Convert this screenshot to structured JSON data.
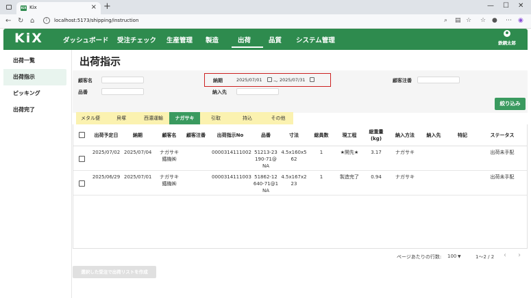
{
  "browser": {
    "tab_title": "Kix",
    "favicon_text": "KiX",
    "url": "localhost:5173/shipping/instruction"
  },
  "app": {
    "logo": "KiX",
    "nav": [
      "ダッシュボード",
      "受注チェック",
      "生産管理",
      "製造",
      "出荷",
      "品質",
      "システム管理"
    ],
    "active_nav": "出荷",
    "user_name": "鉄鋼太郎"
  },
  "sidebar": {
    "items": [
      {
        "label": "出荷一覧",
        "active": false
      },
      {
        "label": "出荷指示",
        "active": true
      },
      {
        "label": "ピッキング",
        "active": false
      },
      {
        "label": "出荷完了",
        "active": false
      }
    ]
  },
  "page": {
    "title": "出荷指示"
  },
  "filters": {
    "customer_label": "顧客名",
    "customer_value": "",
    "part_label": "品番",
    "part_value": "",
    "due_label": "納期",
    "due_from": "2025/07/01",
    "due_sep": "〜",
    "due_to": "2025/07/31",
    "destination_label": "納入先",
    "destination_value": "",
    "order_no_label": "顧客注番",
    "order_no_value": "",
    "submit_label": "絞り込み"
  },
  "carrier_tabs": [
    "メタル便",
    "貝塚",
    "西濃運輸",
    "ナガサキ",
    "引取",
    "持込",
    "その他"
  ],
  "active_carrier": "ナガサキ",
  "table": {
    "headers": [
      "出荷予定日",
      "納期",
      "顧客名",
      "顧客注番",
      "出荷指示No",
      "品番",
      "寸法",
      "総員数",
      "現工程",
      "総重量\n(kg)",
      "納入方法",
      "納入先",
      "特記",
      "ステータス"
    ],
    "rows": [
      {
        "ship_date": "2025/07/02",
        "due": "2025/07/04",
        "customer": "ナガサキ\n鐵機㈱",
        "order_no": "",
        "instruction_no": "0000314111002",
        "part": "51213-23\n190-71@\nNA",
        "size": "4.5x160x5\n62",
        "qty": "1",
        "process": "★開先★",
        "weight": "3.17",
        "method": "ナガサキ",
        "destination": "",
        "note": "",
        "status": "出荷未手配"
      },
      {
        "ship_date": "2025/06/29",
        "due": "2025/07/01",
        "customer": "ナガサキ\n鐵機㈱",
        "order_no": "",
        "instruction_no": "0000314111003",
        "part": "51862-12\n640-71@1\nNA",
        "size": "4.5x167x2\n23",
        "qty": "1",
        "process": "製造完了",
        "weight": "0.94",
        "method": "ナガサキ",
        "destination": "",
        "note": "",
        "status": "出荷未手配"
      }
    ]
  },
  "pagination": {
    "rows_label": "ページあたりの行数:",
    "rows_value": "100",
    "range": "1〜2 / 2"
  },
  "create_button": "選択した受注で出荷リストを作成",
  "colors": {
    "brand_green": "#2e8b4e",
    "tab_yellow": "#fbf2b0",
    "highlight_red": "#cc1f1f"
  }
}
